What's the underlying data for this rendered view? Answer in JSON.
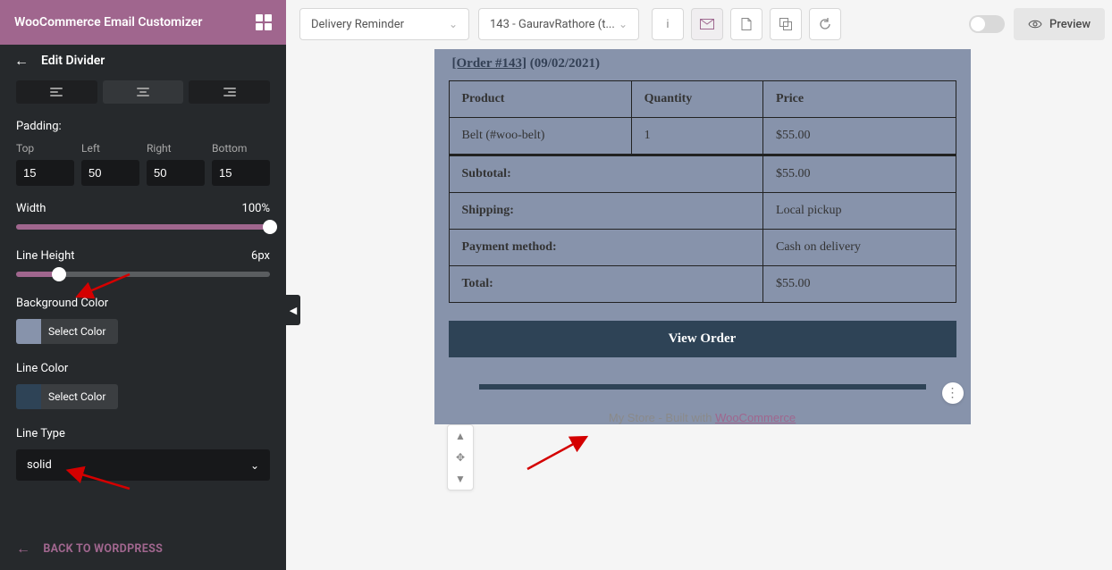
{
  "brand": {
    "title": "WooCommerce Email Customizer"
  },
  "panel": {
    "title": "Edit Divider",
    "padding_label": "Padding:",
    "padding": {
      "top_label": "Top",
      "top": "15",
      "left_label": "Left",
      "left": "50",
      "right_label": "Right",
      "right": "50",
      "bottom_label": "Bottom",
      "bottom": "15"
    },
    "width": {
      "label": "Width",
      "value": "100%"
    },
    "line_height": {
      "label": "Line Height",
      "value": "6px"
    },
    "bg_color": {
      "label": "Background Color",
      "button": "Select Color",
      "swatch": "#8793ab"
    },
    "line_color": {
      "label": "Line Color",
      "button": "Select Color",
      "swatch": "#2e4356"
    },
    "line_type": {
      "label": "Line Type",
      "value": "solid"
    },
    "footer_link": "BACK TO WORDPRESS"
  },
  "topbar": {
    "template_select": "Delivery Reminder",
    "order_select": "143 - GauravRathore (t...",
    "preview": "Preview"
  },
  "email": {
    "order_link": "[Order #143]",
    "order_date": "(09/02/2021)",
    "headers": {
      "product": "Product",
      "quantity": "Quantity",
      "price": "Price"
    },
    "item": {
      "name": "Belt (#woo-belt)",
      "qty": "1",
      "price": "$55.00"
    },
    "totals": {
      "subtotal_label": "Subtotal:",
      "subtotal": "$55.00",
      "shipping_label": "Shipping:",
      "shipping": "Local pickup",
      "payment_label": "Payment method:",
      "payment": "Cash on delivery",
      "total_label": "Total:",
      "total": "$55.00"
    },
    "view_order": "View Order",
    "footer_prefix": "My Store - Built with ",
    "footer_link": "WooCommerce"
  }
}
